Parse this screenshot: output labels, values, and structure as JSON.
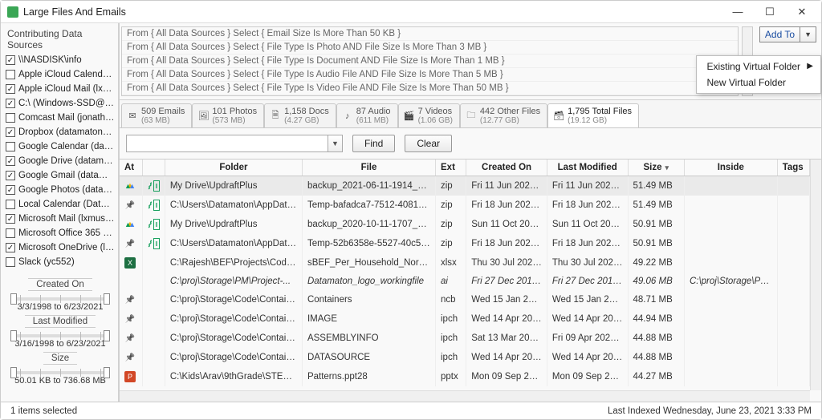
{
  "window": {
    "title": "Large Files And Emails"
  },
  "sidebar": {
    "header": "Contributing Data Sources",
    "sources": [
      {
        "label": "\\\\NASDISK\\info",
        "checked": true
      },
      {
        "label": "Apple iCloud Calendar ...",
        "checked": false
      },
      {
        "label": "Apple iCloud Mail (lxm...",
        "checked": true
      },
      {
        "label": "C:\\ (Windows-SSD@RS...",
        "checked": true
      },
      {
        "label": "Comcast Mail (jonatha...",
        "checked": false
      },
      {
        "label": "Dropbox (datamaton@...",
        "checked": true
      },
      {
        "label": "Google Calendar (data...",
        "checked": false
      },
      {
        "label": "Google Drive (datamat...",
        "checked": true
      },
      {
        "label": "Google Gmail (datama...",
        "checked": true
      },
      {
        "label": "Google Photos (datam...",
        "checked": true
      },
      {
        "label": "Local Calendar (Datam...",
        "checked": false
      },
      {
        "label": "Microsoft Mail (lxmuser)",
        "checked": true
      },
      {
        "label": "Microsoft Office 365 E...",
        "checked": false
      },
      {
        "label": "Microsoft OneDrive (lx...",
        "checked": true
      },
      {
        "label": "Slack (yc552)",
        "checked": false
      }
    ],
    "filters": {
      "createdOn": {
        "label": "Created On",
        "value": "3/3/1998 to 6/23/2021"
      },
      "lastModified": {
        "label": "Last Modified",
        "value": "3/16/1998 to 6/23/2021"
      },
      "size": {
        "label": "Size",
        "value": "50.01 KB to 736.68 MB"
      }
    }
  },
  "queries": [
    "From { All Data Sources } Select { Email Size Is More Than 50 KB }",
    "From { All Data Sources } Select { File Type Is Photo AND File Size Is More Than 3 MB }",
    "From { All Data Sources } Select { File Type Is Document AND File Size Is More Than 1 MB }",
    "From { All Data Sources } Select { File Type Is Audio File AND File Size Is More Than 5 MB }",
    "From { All Data Sources } Select { File Type Is Video File AND File Size Is More Than 50 MB }"
  ],
  "addTo": {
    "label": "Add To",
    "menu": {
      "existing": "Existing Virtual Folder",
      "newFolder": "New Virtual Folder"
    }
  },
  "tabs": [
    {
      "icon": "✉",
      "title": "509 Emails",
      "sub": "(63 MB)"
    },
    {
      "icon": "🖼",
      "title": "101 Photos",
      "sub": "(573 MB)"
    },
    {
      "icon": "🗎",
      "title": "1,158 Docs",
      "sub": "(4.27 GB)"
    },
    {
      "icon": "♪",
      "title": "87 Audio",
      "sub": "(611 MB)"
    },
    {
      "icon": "🎬",
      "title": "7 Videos",
      "sub": "(1.06 GB)"
    },
    {
      "icon": "🗀",
      "title": "442 Other Files",
      "sub": "(12.77 GB)"
    },
    {
      "icon": "🗃",
      "title": "1,795 Total Files",
      "sub": "(19.12 GB)"
    }
  ],
  "search": {
    "find": "Find",
    "clear": "Clear"
  },
  "columns": {
    "at": "At",
    "folder": "Folder",
    "file": "File",
    "ext": "Ext",
    "created": "Created On",
    "modified": "Last Modified",
    "size": "Size",
    "inside": "Inside",
    "tags": "Tags"
  },
  "rows": [
    {
      "service": "drive",
      "dup": true,
      "folder": "My Drive\\UpdraftPlus",
      "file": "backup_2021-06-11-1914_Dat...",
      "ext": "zip",
      "created": "Fri 11 Jun 2021, 7:52 ...",
      "modified": "Fri 11 Jun 2021, 7:52...",
      "size": "51.49 MB",
      "green": true,
      "sel": true
    },
    {
      "service": "pin",
      "dup": true,
      "folder": "C:\\Users\\Datamaton\\AppData\\L...",
      "file": "Temp-bafadca7-7512-4081-b...",
      "ext": "zip",
      "created": "Fri 18 Jun 2021, 2:21 ...",
      "modified": "Fri 18 Jun 2021, 2:21 ...",
      "size": "51.49 MB",
      "green": true
    },
    {
      "service": "drive",
      "dup": true,
      "folder": "My Drive\\UpdraftPlus",
      "file": "backup_2020-10-11-1707_Dat...",
      "ext": "zip",
      "created": "Sun 11 Oct 2020, 5:0...",
      "modified": "Sun 11 Oct 2020, 5:0...",
      "size": "50.91 MB"
    },
    {
      "service": "pin",
      "dup": true,
      "folder": "C:\\Users\\Datamaton\\AppData\\L...",
      "file": "Temp-52b6358e-5527-40c5-8...",
      "ext": "zip",
      "created": "Fri 18 Jun 2021, 2:23 ...",
      "modified": "Fri 18 Jun 2021, 2:23 ...",
      "size": "50.91 MB",
      "green": true
    },
    {
      "service": "excel",
      "folder": "C:\\Rajesh\\BEF\\Projects\\Code\\Scr...",
      "file": "sBEF_Per_Household_Normal...",
      "ext": "xlsx",
      "created": "Thu 30 Jul 2020, 7:49...",
      "modified": "Thu 30 Jul 2020, 7:49...",
      "size": "49.22 MB"
    },
    {
      "folder": "C:\\proj\\Storage\\PM\\Project-...",
      "file": "Datamaton_logo_workingfile",
      "ext": "ai",
      "created": "Fri 27 Dec 2019, 8:1...",
      "modified": "Fri 27 Dec 2019, 8:1...",
      "size": "49.06 MB",
      "inside": "C:\\proj\\Storage\\PM\\Pro...",
      "italic": true
    },
    {
      "service": "pin",
      "folder": "C:\\proj\\Storage\\Code\\Container...",
      "file": "Containers",
      "ext": "ncb",
      "created": "Wed 15 Jan 2014, 11...",
      "modified": "Wed 15 Jan 2014, 11...",
      "size": "48.71 MB"
    },
    {
      "service": "pin",
      "folder": "C:\\proj\\Storage\\Code\\Container...",
      "file": "IMAGE",
      "ext": "ipch",
      "created": "Wed 14 Apr 2021, 8:...",
      "modified": "Wed 14 Apr 2021, 8:...",
      "size": "44.94 MB"
    },
    {
      "service": "pin",
      "folder": "C:\\proj\\Storage\\Code\\Container...",
      "file": "ASSEMBLYINFO",
      "ext": "ipch",
      "created": "Sat 13 Mar 2021, 12:...",
      "modified": "Fri 09 Apr 2021, 9:33...",
      "size": "44.88 MB"
    },
    {
      "service": "pin",
      "folder": "C:\\proj\\Storage\\Code\\Container...",
      "file": "DATASOURCE",
      "ext": "ipch",
      "created": "Wed 14 Apr 2021, 10...",
      "modified": "Wed 14 Apr 2021, 10...",
      "size": "44.88 MB"
    },
    {
      "service": "ppt",
      "folder": "C:\\Kids\\Arav\\9thGrade\\STEMPhy...",
      "file": "Patterns.ppt28",
      "ext": "pptx",
      "created": "Mon 09 Sep 2019, 5:...",
      "modified": "Mon 09 Sep 2019, 5:...",
      "size": "44.27 MB"
    }
  ],
  "status": {
    "left": "1 items selected",
    "right": "Last Indexed Wednesday, June 23, 2021 3:33 PM"
  }
}
